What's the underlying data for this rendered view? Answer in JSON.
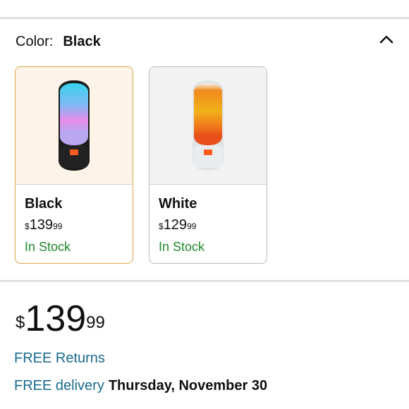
{
  "variant": {
    "label": "Color:",
    "selected": "Black",
    "options": [
      {
        "name": "Black",
        "price_symbol": "$",
        "price_whole": "139",
        "price_cents": "99",
        "stock": "In Stock"
      },
      {
        "name": "White",
        "price_symbol": "$",
        "price_whole": "129",
        "price_cents": "99",
        "stock": "In Stock"
      }
    ]
  },
  "price": {
    "symbol": "$",
    "whole": "139",
    "cents": "99"
  },
  "returns": {
    "label": "FREE Returns"
  },
  "delivery": {
    "prefix": "FREE delivery",
    "date": "Thursday, November 30"
  },
  "colors": {
    "selected_border": "#d9a546",
    "selected_bg": "#fdf3e8",
    "stock": "#218a2b",
    "link": "#176a8e"
  },
  "icons": {
    "collapse": "chevron-up-icon"
  }
}
